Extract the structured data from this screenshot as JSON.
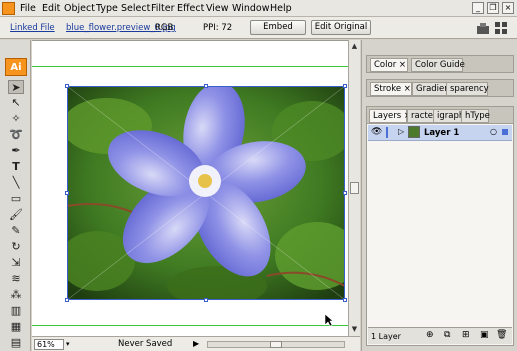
{
  "menubar": {
    "items": [
      "File",
      "Edit",
      "Object",
      "Type",
      "Select",
      "Filter",
      "Effect",
      "View",
      "Window",
      "Help"
    ]
  },
  "controlbar": {
    "status": "Linked File",
    "filename": "blue_flower.preview_0.jpg",
    "colormode": "RGB",
    "ppi": "PPI: 72",
    "embed_label": "Embed",
    "edit_original_label": "Edit Original"
  },
  "tools": {
    "logo": "Ai"
  },
  "statusbar": {
    "zoom": "61%",
    "save_state": "Never Saved"
  },
  "panels": {
    "color_tabs": [
      "Color",
      "Color Guide"
    ],
    "stroke_tabs": [
      "Stroke",
      "Gradient",
      "sparency"
    ],
    "layers_tabs": [
      "Layers",
      "racter",
      "igraph",
      "hType"
    ],
    "layer_name": "Layer 1",
    "layer_count": "1 Layer"
  },
  "colors": {
    "accent": "#f7941d",
    "selection": "#3a5fcd",
    "artboard_guide": "#3ec63e"
  }
}
